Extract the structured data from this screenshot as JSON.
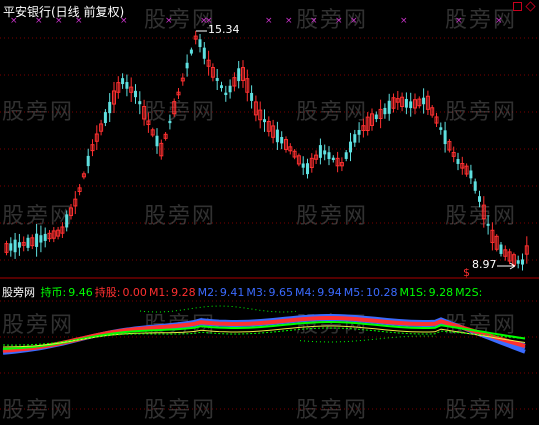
{
  "title": "平安银行(日线 前复权)",
  "watermark": "股旁网",
  "price_high_label": "15.34",
  "price_low_label": "8.97",
  "signal_marker": "$",
  "legend": {
    "name": "股旁网",
    "items": [
      {
        "label": "持币:",
        "value": "9.46",
        "color": "#00ff00"
      },
      {
        "label": "持股:",
        "value": "0.00",
        "color": "#ff3030"
      },
      {
        "label": "M1:",
        "value": "9.28",
        "color": "#ff3030"
      },
      {
        "label": "M2:",
        "value": "9.41",
        "color": "#3b6bff"
      },
      {
        "label": "M3:",
        "value": "9.65",
        "color": "#3b6bff"
      },
      {
        "label": "M4:",
        "value": "9.94",
        "color": "#3b6bff"
      },
      {
        "label": "M5:",
        "value": "10.28",
        "color": "#3b6bff"
      },
      {
        "label": "M1S:",
        "value": "9.28",
        "color": "#00ff00"
      },
      {
        "label": "M2S:",
        "value": "",
        "color": "#00ff00"
      }
    ]
  },
  "colors": {
    "up": "#ff3030",
    "down": "#5fe0e0",
    "grid": "#7a0000",
    "marker": "#cc33cc"
  }
}
